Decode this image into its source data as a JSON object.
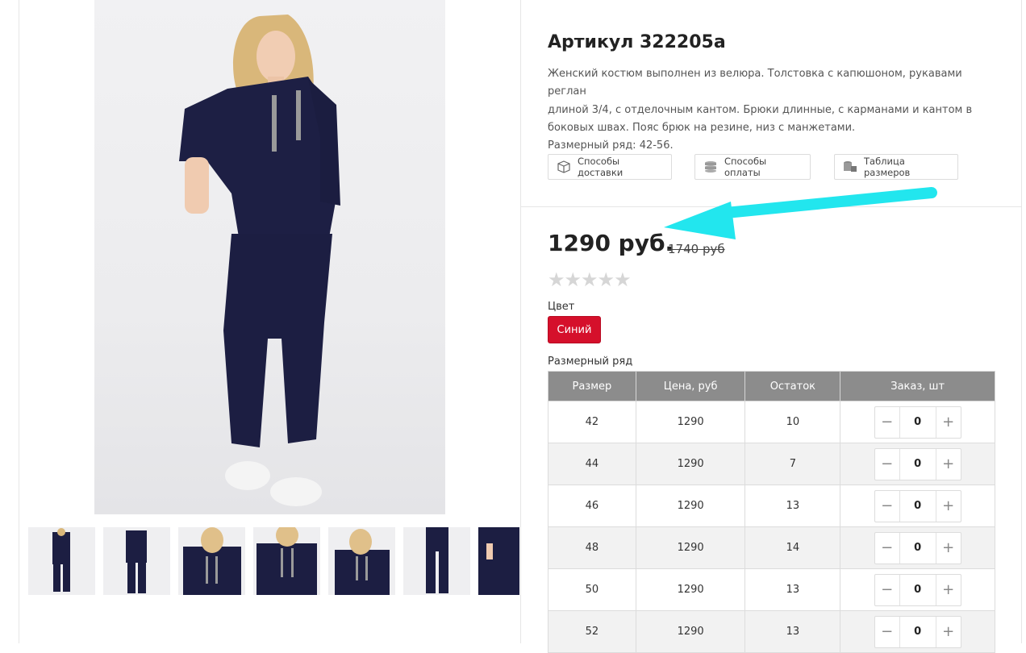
{
  "product": {
    "title": "Артикул 322205а",
    "description_lines": [
      "Женский костюм выполнен из велюра. Толстовка с капюшоном, рукавами реглан",
      "длиной 3/4, с отделочным кантом. Брюки длинные, с карманами и кантом в",
      "боковых швах. Пояс брюк на резине, низ с манжетами.",
      "Размерный ряд: 42-56."
    ],
    "price": "1290 руб.",
    "old_price": "1740 руб",
    "rating_stars": 5,
    "rating_filled": 0
  },
  "info_buttons": {
    "delivery": "Способы доставки",
    "payment": "Способы оплаты",
    "sizes_table": "Таблица размеров"
  },
  "color": {
    "label": "Цвет",
    "selected": "Синий",
    "accent": "#d5102b"
  },
  "size_table": {
    "label": "Размерный ряд",
    "headers": [
      "Размер",
      "Цена, руб",
      "Остаток",
      "Заказ, шт"
    ],
    "rows": [
      {
        "size": "42",
        "price": "1290",
        "stock": "10",
        "qty": "0"
      },
      {
        "size": "44",
        "price": "1290",
        "stock": "7",
        "qty": "0"
      },
      {
        "size": "46",
        "price": "1290",
        "stock": "13",
        "qty": "0"
      },
      {
        "size": "48",
        "price": "1290",
        "stock": "14",
        "qty": "0"
      },
      {
        "size": "50",
        "price": "1290",
        "stock": "13",
        "qty": "0"
      },
      {
        "size": "52",
        "price": "1290",
        "stock": "13",
        "qty": "0"
      }
    ],
    "minus": "−",
    "plus": "+"
  },
  "gallery": {
    "thumbnail_count": 7
  },
  "annotation": {
    "arrow_color": "#22e6ee"
  }
}
